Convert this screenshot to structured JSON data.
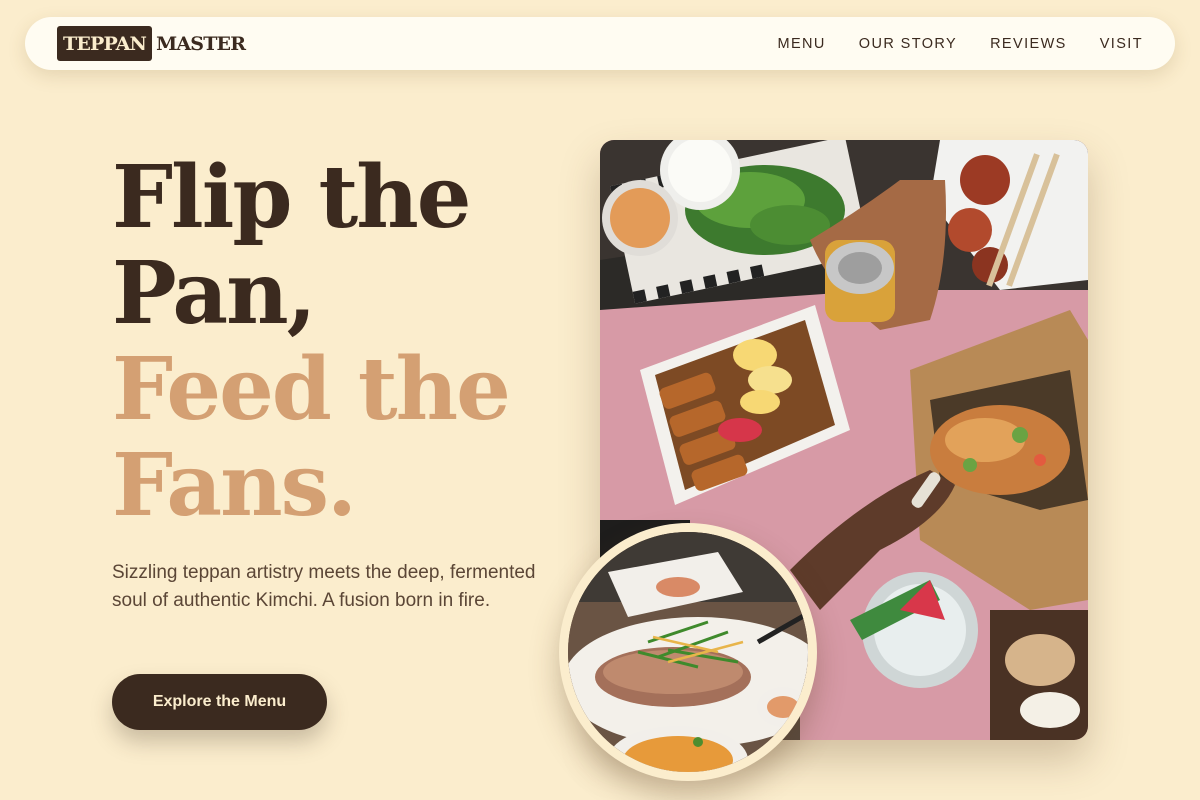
{
  "brand": {
    "logo_boxed": "TEPPAN",
    "logo_rest": "MASTER"
  },
  "nav": {
    "links": [
      {
        "label": "MENU"
      },
      {
        "label": "OUR STORY"
      },
      {
        "label": "REVIEWS"
      },
      {
        "label": "VISIT"
      }
    ]
  },
  "hero": {
    "headline_line1": "Flip the",
    "headline_line2": "Pan,",
    "headline_line3": "Feed the",
    "headline_line4": "Fans.",
    "subtext": "Sizzling teppan artistry meets the deep, fermented soul of authentic Kimchi. A fusion born in fire.",
    "cta_label": "Explore the Menu"
  },
  "colors": {
    "background": "#fbedcd",
    "primary_dark": "#3b2a1f",
    "accent_tan": "#d4a073",
    "nav_bg": "#fffcf2"
  },
  "images": {
    "main_photo": "food-spread-photo",
    "circle_photo": "grilled-fish-dish-photo"
  }
}
